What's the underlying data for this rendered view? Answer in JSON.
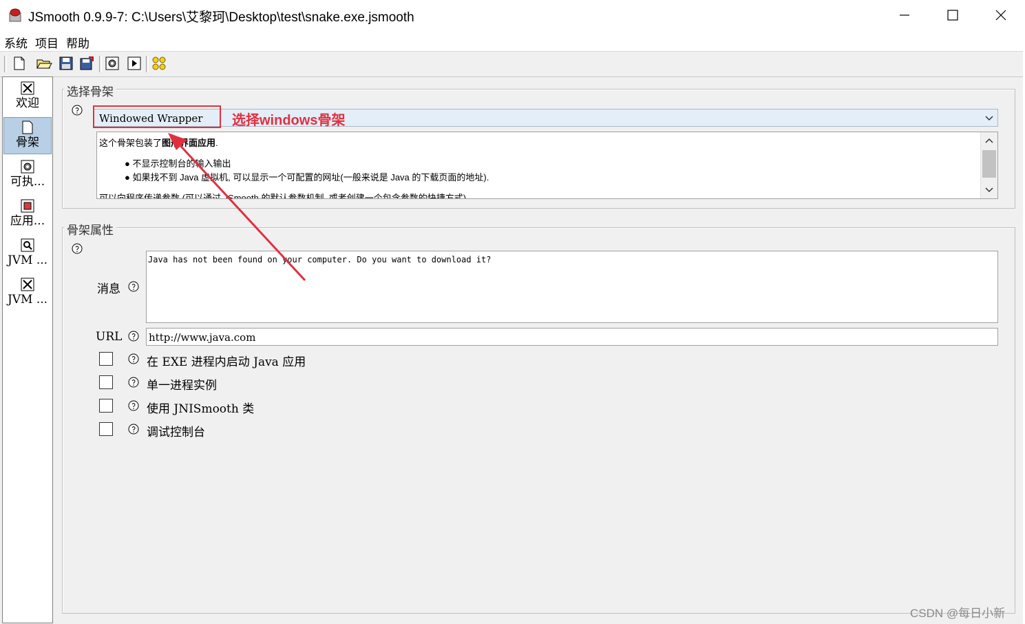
{
  "window": {
    "title": "JSmooth 0.9.9-7: C:\\Users\\艾黎珂\\Desktop\\test\\snake.exe.jsmooth"
  },
  "menu": [
    "系统",
    "项目",
    "帮助"
  ],
  "toolbar": {
    "buttons": [
      "new-file-icon",
      "open-folder-icon",
      "save-icon",
      "save-as-icon",
      "compile-gear-icon",
      "run-icon",
      "stars-icon"
    ]
  },
  "sidebar": {
    "items": [
      {
        "label": "欢迎",
        "icon": "welcome-icon",
        "active": false
      },
      {
        "label": "骨架",
        "icon": "skeleton-icon",
        "active": true
      },
      {
        "label": "可执...",
        "icon": "executable-gear-icon",
        "active": false
      },
      {
        "label": "应用...",
        "icon": "application-icon",
        "active": false
      },
      {
        "label": "JVM ...",
        "icon": "jvm-search-icon",
        "active": false
      },
      {
        "label": "JVM ...",
        "icon": "jvm-config-icon",
        "active": false
      }
    ]
  },
  "skeleton_select": {
    "group_title": "选择骨架",
    "selected": "Windowed Wrapper",
    "description": {
      "intro_plain": "这个骨架包装了",
      "intro_bold": "图形界面应用",
      "intro_end": ".",
      "bullet1": "不显示控制台的输入输出",
      "bullet2": "如果找不到 Java 虚拟机, 可以显示一个可配置的网址(一般来说是 Java 的下载页面的地址).",
      "footer": "可以向程序传递参数 (可以通过 JSmooth 的默认参数机制, 或者创建一个包含参数的快捷方式)"
    }
  },
  "skeleton_props": {
    "group_title": "骨架属性",
    "message_label": "消息",
    "message_value": "Java has not been found on your computer. Do you want to download it?",
    "url_label": "URL",
    "url_value": "http://www.java.com",
    "checkboxes": [
      {
        "label": "在 EXE 进程内启动 Java 应用",
        "checked": false
      },
      {
        "label": "单一进程实例",
        "checked": false
      },
      {
        "label": "使用 JNISmooth 类",
        "checked": false
      },
      {
        "label": "调试控制台",
        "checked": false
      }
    ]
  },
  "annotation": {
    "text": "选择windows骨架",
    "color": "#e03040"
  },
  "watermark": "CSDN @每日小新"
}
